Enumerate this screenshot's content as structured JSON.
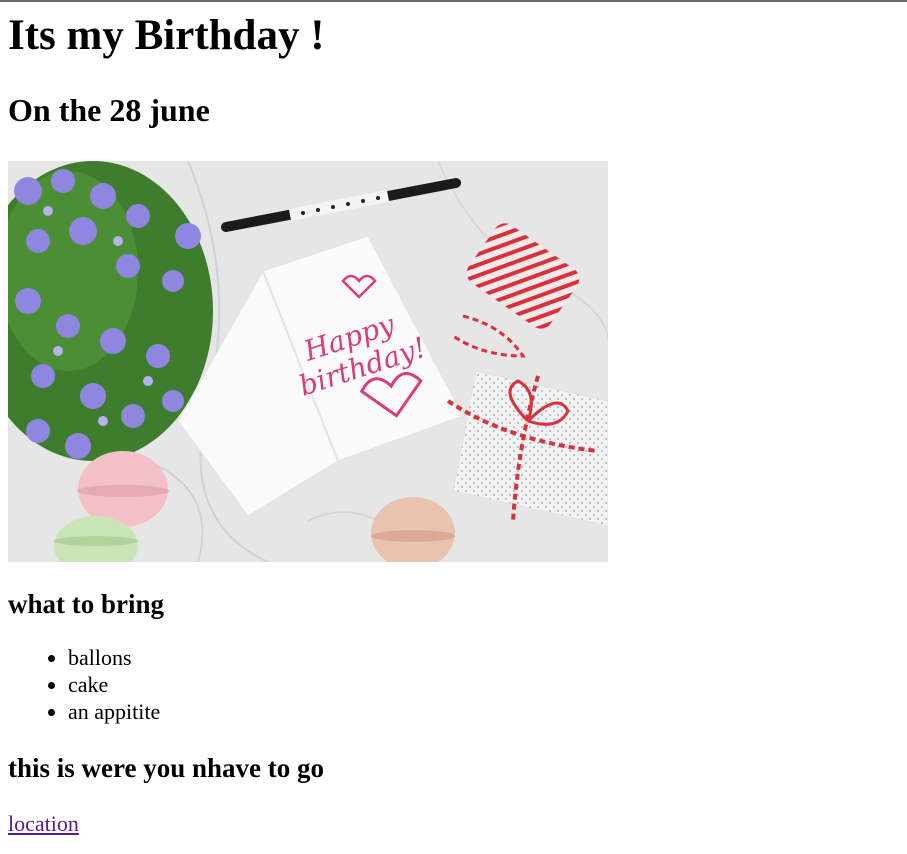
{
  "page": {
    "title": "Its my Birthday !",
    "date_heading": "On the 28 june",
    "image_description": "Birthday card, flowers, macarons, gift box, twine spool and pen",
    "bring_heading": "what to bring",
    "bring_items": [
      "ballons",
      "cake",
      "an appitite"
    ],
    "location_heading": "this is were you nhave to go",
    "location_link": "location"
  }
}
